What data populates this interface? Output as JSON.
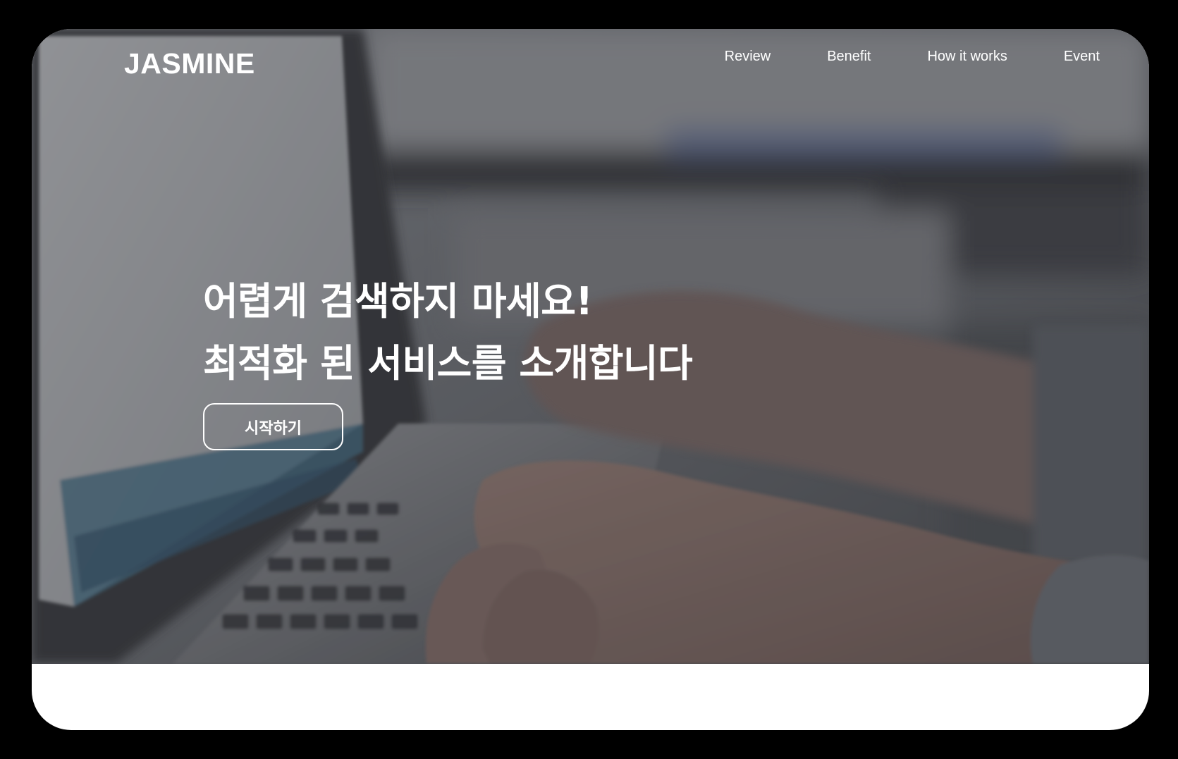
{
  "brand": {
    "logo": "JASMINE"
  },
  "nav": {
    "items": [
      {
        "label": "Review"
      },
      {
        "label": "Benefit"
      },
      {
        "label": "How it works"
      },
      {
        "label": "Event"
      }
    ]
  },
  "hero": {
    "headline_line1": "어렵게 검색하지 마세요!",
    "headline_line2": "최적화 된 서비스를 소개합니다",
    "cta_label": "시작하기",
    "image_subject": "hands typing on laptop keyboard"
  },
  "colors": {
    "frame": "#000000",
    "hero_overlay": "#46484e",
    "text": "#ffffff",
    "page_background": "#ffffff"
  }
}
